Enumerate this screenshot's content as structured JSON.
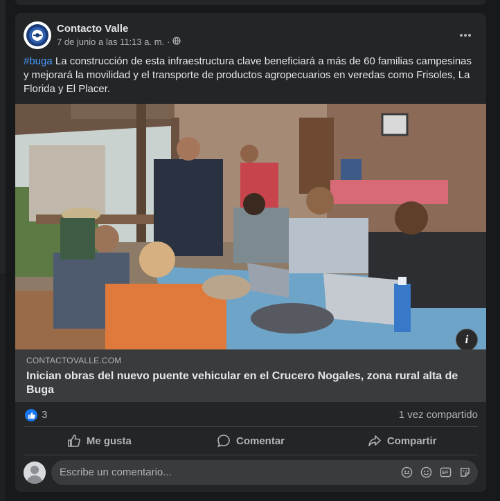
{
  "post": {
    "author": "Contacto Valle",
    "timestamp": "7 de junio a las 11:13 a. m.",
    "separator": "·",
    "audience_icon": "globe-icon",
    "hashtag": "#buga",
    "body": " La construcción de esta infraestructura clave beneficiará a más de 60 familias campesinas y mejorará la movilidad y el transporte de productos agropecuarios en veredas como Frisoles, La Florida y El Placer."
  },
  "link_preview": {
    "domain": "CONTACTOVALLE.COM",
    "title": "Inician obras del nuevo puente vehicular en el Crucero Nogales, zona rural alta de Buga",
    "info_label": "i"
  },
  "stats": {
    "likes": "3",
    "shares": "1 vez compartido"
  },
  "actions": {
    "like": "Me gusta",
    "comment": "Comentar",
    "share": "Compartir"
  },
  "comment_box": {
    "placeholder": "Escribe un comentario..."
  },
  "colors": {
    "background": "#18191a",
    "card": "#242526",
    "accent": "#1877f2",
    "hashtag": "#4599ff"
  }
}
